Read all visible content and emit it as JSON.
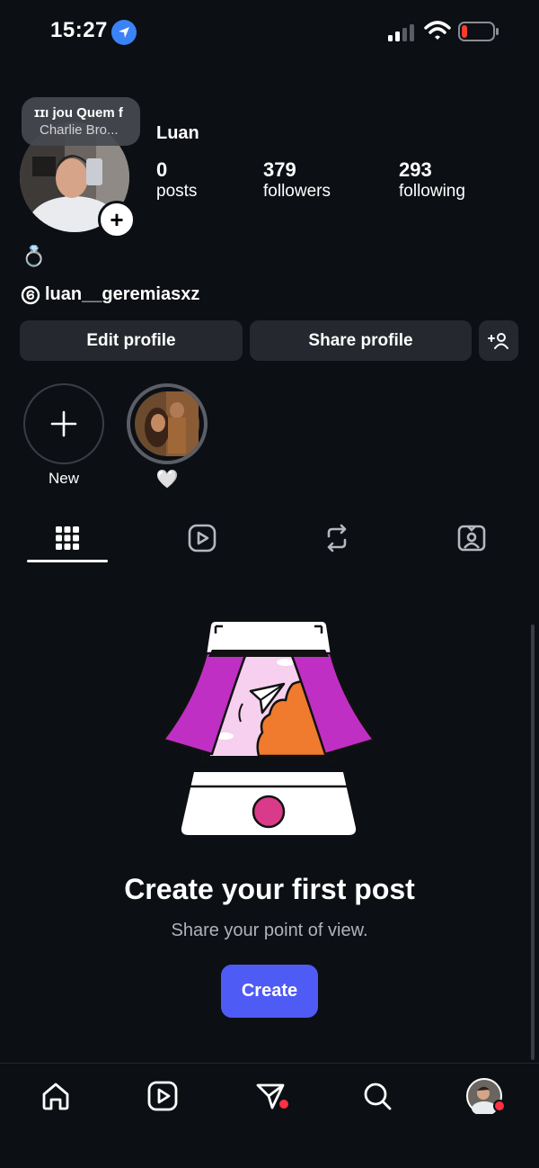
{
  "status_bar": {
    "time": "15:27",
    "icons": [
      "location-arrow-icon",
      "signal-icon",
      "wifi-icon",
      "battery-low-icon"
    ],
    "battery_color": "#ff3b30"
  },
  "profile": {
    "name": "Luan",
    "music_note": {
      "line1": "ɪɪı jou Quem f",
      "line2": "Charlie Bro..."
    },
    "stats": [
      {
        "value": "0",
        "label": "posts"
      },
      {
        "value": "379",
        "label": "followers"
      },
      {
        "value": "293",
        "label": "following"
      }
    ],
    "bio_emoji": "💍",
    "threads_handle": "luan__geremiasxz"
  },
  "actions": {
    "edit": "Edit profile",
    "share": "Share profile"
  },
  "highlights": [
    {
      "label": "New"
    },
    {
      "label": "🤍"
    }
  ],
  "tabs": [
    "grid-icon",
    "reels-icon",
    "reposts-icon",
    "tagged-icon"
  ],
  "empty_state": {
    "title": "Create your first post",
    "subtitle": "Share your point of view.",
    "button": "Create"
  },
  "bottom_nav": [
    "home-icon",
    "reels-icon",
    "direct-messages-icon",
    "search-icon",
    "profile-avatar"
  ],
  "colors": {
    "background": "#0c0f14",
    "button_bg": "#25282e",
    "primary": "#4f5bf5",
    "notification": "#ff3040",
    "illustration_magenta": "#c02fc4",
    "illustration_orange": "#f07a2d",
    "illustration_pink": "#f6d0ee"
  }
}
